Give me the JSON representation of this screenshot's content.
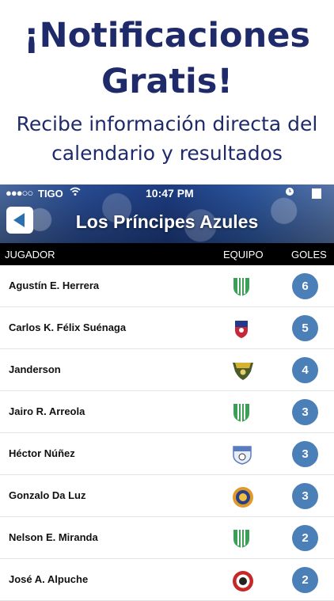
{
  "promo": {
    "title_line1": "¡Notificaciones",
    "title_line2": "Gratis!",
    "subtitle_line1": "Recibe información directa del",
    "subtitle_line2": "calendario y resultados"
  },
  "status_bar": {
    "signal": "●●●○○",
    "carrier": "TIGO",
    "time": "10:47 PM"
  },
  "header": {
    "title": "Los Príncipes Azules"
  },
  "table": {
    "col_player": "JUGADOR",
    "col_team": "EQUIPO",
    "col_goals": "GOLES",
    "rows": [
      {
        "player": "Agustín E. Herrera",
        "crest": "green-white-crest-icon",
        "goals": "6"
      },
      {
        "player": "Carlos K. Félix Suénaga",
        "crest": "red-blue-crest-icon",
        "goals": "5"
      },
      {
        "player": "Janderson",
        "crest": "yellow-green-crest-icon",
        "goals": "4"
      },
      {
        "player": "Jairo R. Arreola",
        "crest": "green-white-crest-icon",
        "goals": "3"
      },
      {
        "player": "Héctor Núñez",
        "crest": "blue-white-crest-icon",
        "goals": "3"
      },
      {
        "player": "Gonzalo Da Luz",
        "crest": "orange-blue-crest-icon",
        "goals": "3"
      },
      {
        "player": "Nelson E. Miranda",
        "crest": "green-white-crest-icon",
        "goals": "2"
      },
      {
        "player": "José A. Alpuche",
        "crest": "red-round-crest-icon",
        "goals": "2"
      }
    ]
  },
  "colors": {
    "promo_text": "#1f2a6b",
    "badge": "#4a7fb8",
    "back_arrow": "#2a6fb0"
  }
}
